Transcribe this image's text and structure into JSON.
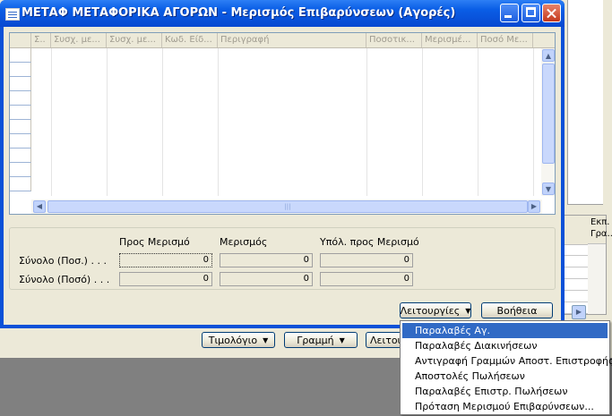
{
  "window": {
    "title": "ΜΕΤΑΦ ΜΕΤΑΦΟΡΙΚΑ ΑΓΟΡΩΝ - Μερισμός Επιβαρύνσεων (Αγορές)"
  },
  "grid": {
    "columns": [
      "Σ..",
      "Συσχ. με...",
      "Συσχ. με...",
      "Κωδ. Είδ...",
      "Περιγραφή",
      "Ποσοτικ...",
      "Μερισμέ...",
      "Ποσό Με..."
    ]
  },
  "totals": {
    "headers": [
      "Προς Μερισμό",
      "Μερισμός",
      "Υπόλ. προς Μερισμό"
    ],
    "rows": [
      {
        "label": "Σύνολο (Ποσ.) . . .",
        "values": [
          "0",
          "0",
          "0"
        ]
      },
      {
        "label": "Σύνολο (Ποσό) . . .",
        "values": [
          "0",
          "0",
          "0"
        ]
      }
    ]
  },
  "buttons": {
    "functions": "Λειτουργίες",
    "help": "Βοήθεια",
    "invoice": "Τιμολόγιο",
    "line": "Γραμμή",
    "functions_partial": "Λειτουρ"
  },
  "background": {
    "column_header": "Εκπ. Γρα.."
  },
  "menu": {
    "items": [
      "Παραλαβές Αγ.",
      "Παραλαβές Διακινήσεων",
      "Αντιγραφή Γραμμών Αποστ. Επιστροφής",
      "Αποστολές Πωλήσεων",
      "Παραλαβές Επιστρ. Πωλήσεων",
      "Πρόταση Μερισμού Επιβαρύνσεων..."
    ],
    "selected_index": 0
  },
  "colors": {
    "title_bar": "#0a5ee6",
    "menu_highlight": "#316ac5",
    "desktop": "#808080"
  }
}
